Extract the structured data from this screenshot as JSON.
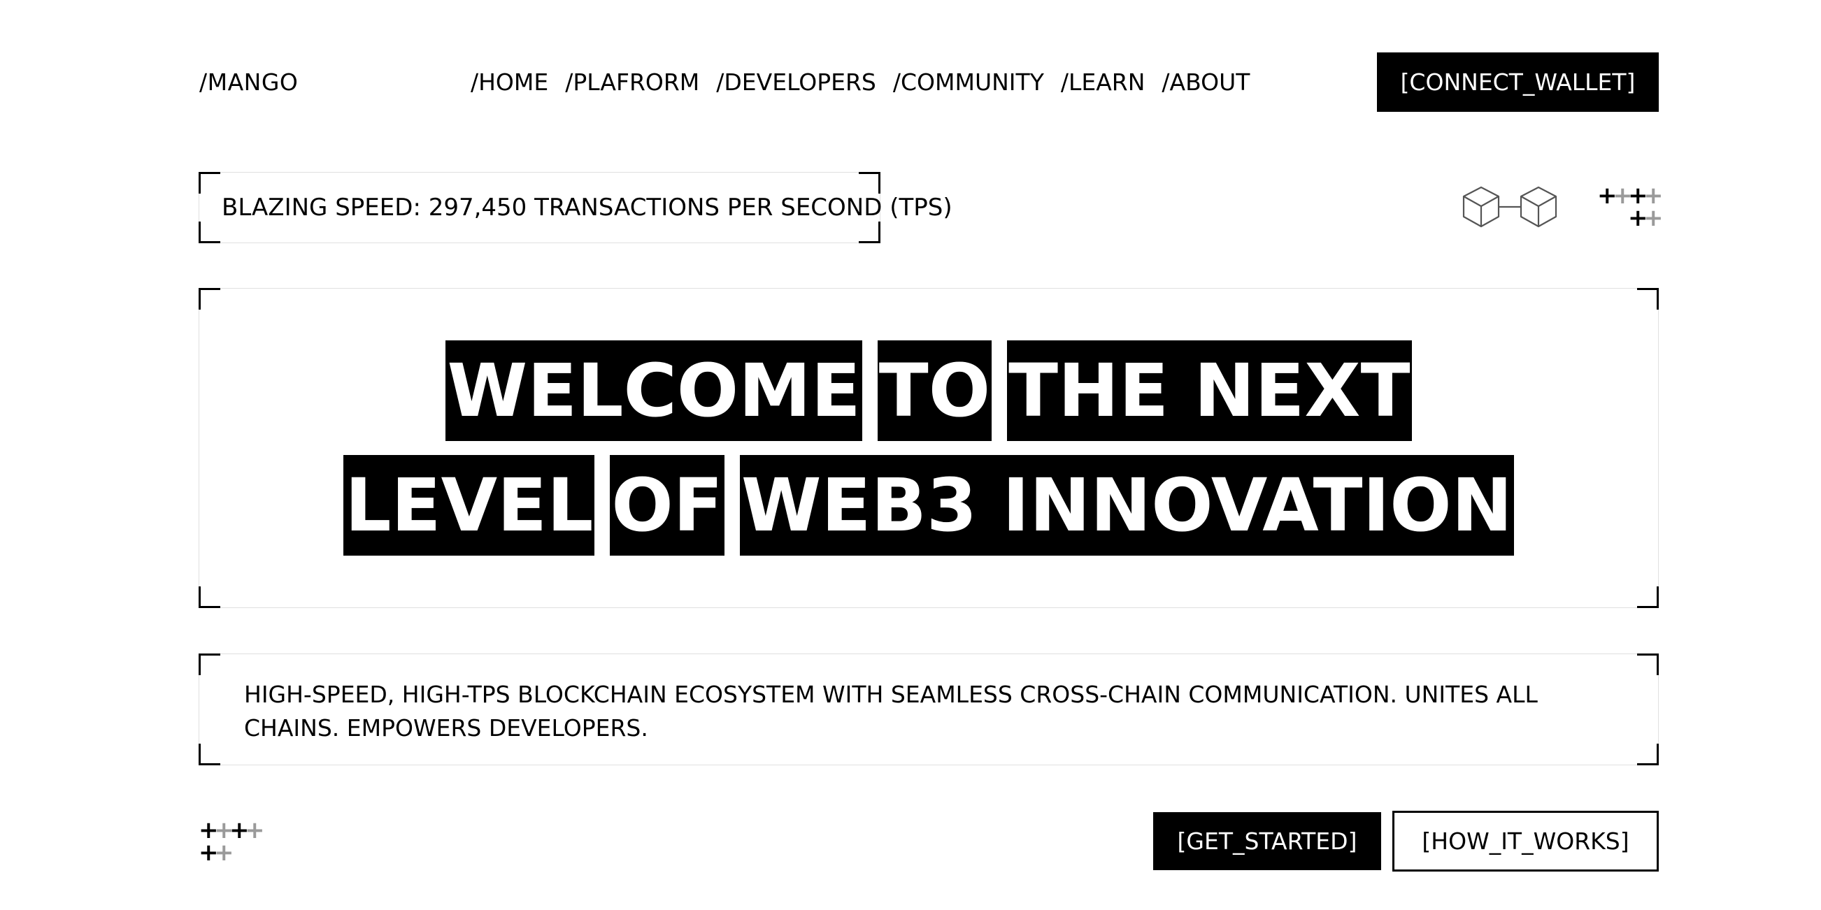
{
  "header": {
    "logo": "/MANGO",
    "nav": [
      "/HOME",
      "/PLAFRORM",
      "/DEVELOPERS",
      "/COMMUNITY",
      "/LEARN",
      "/ABOUT"
    ],
    "connect_label": "[CONNECT_WALLET]"
  },
  "speed_banner": {
    "text": "BLAZING SPEED: 297,450 TRANSACTIONS PER SECOND (TPS)"
  },
  "hero": {
    "line1": [
      "WELCOME",
      "TO",
      "THE NEXT"
    ],
    "line2": [
      "LEVEL",
      "OF",
      "WEB3 INNOVATION"
    ]
  },
  "description": {
    "text": "HIGH-SPEED, HIGH-TPS BLOCKCHAIN ECOSYSTEM WITH SEAMLESS CROSS-CHAIN COMMUNICATION. UNITES ALL CHAINS. EMPOWERS DEVELOPERS."
  },
  "cta": {
    "get_started_label": "[GET_STARTED]",
    "how_it_works_label": "[HOW_IT_WORKS]"
  },
  "icons": {
    "chain": "blockchain-cubes-icon",
    "plus": "+",
    "plus_colors": {
      "dark": "#000000",
      "light": "#9a9a9a"
    }
  }
}
